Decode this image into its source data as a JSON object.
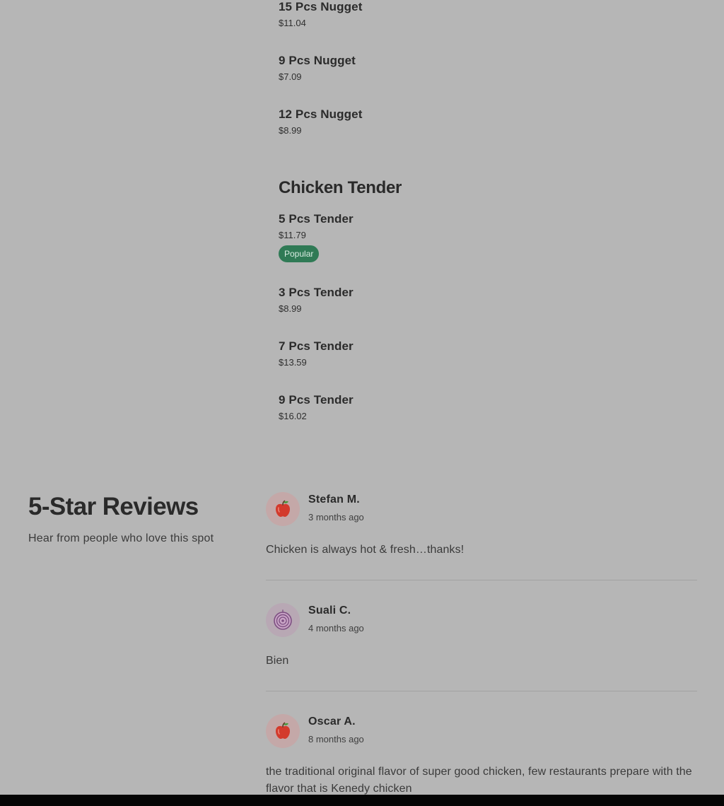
{
  "menu": {
    "nugget_items": [
      {
        "name": "15 Pcs Nugget",
        "price": "$11.04"
      },
      {
        "name": "9 Pcs Nugget",
        "price": "$7.09"
      },
      {
        "name": "12 Pcs Nugget",
        "price": "$8.99"
      }
    ],
    "tender_section": {
      "title": "Chicken Tender",
      "items": [
        {
          "name": "5 Pcs Tender",
          "price": "$11.79",
          "badge": "Popular"
        },
        {
          "name": "3 Pcs Tender",
          "price": "$8.99"
        },
        {
          "name": "7 Pcs Tender",
          "price": "$13.59"
        },
        {
          "name": "9 Pcs Tender",
          "price": "$16.02"
        }
      ]
    }
  },
  "reviews": {
    "heading": "5-Star Reviews",
    "subheading": "Hear from people who love this spot",
    "items": [
      {
        "name": "Stefan M.",
        "time": "3 months ago",
        "text": "Chicken is always hot & fresh…thanks!",
        "avatar_icon": "apple-icon"
      },
      {
        "name": "Suali C.",
        "time": "4 months ago",
        "text": "Bien",
        "avatar_icon": "onion-icon"
      },
      {
        "name": "Oscar A.",
        "time": "8 months ago",
        "text": "the traditional original flavor of super good chicken, few restaurants prepare with the flavor that is Kenedy chicken",
        "avatar_icon": "apple-icon"
      }
    ]
  },
  "colors": {
    "background": "#b6b6b6",
    "badge": "#2f7a55",
    "apple_avatar_bg": "#c4a8a8",
    "onion_avatar_bg": "#b8a8b4"
  }
}
